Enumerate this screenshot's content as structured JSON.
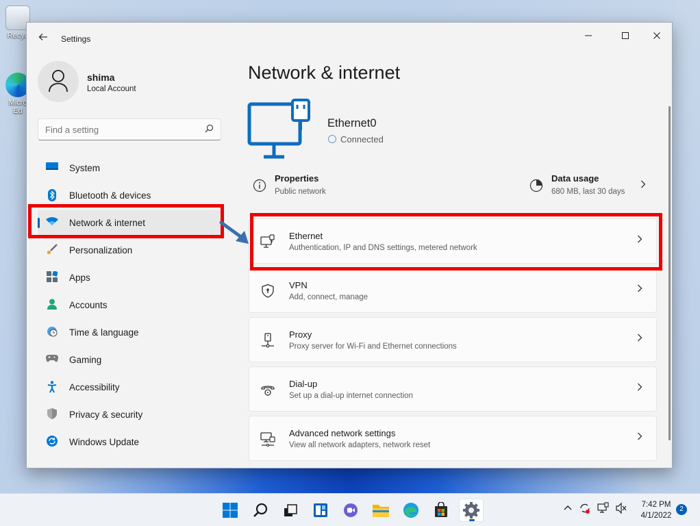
{
  "desktop": {
    "icons": [
      {
        "label": "Recycle Bin",
        "visible_label": "Recyc"
      },
      {
        "label": "Microsoft Edge",
        "visible_label": "Micro Ed"
      }
    ]
  },
  "window": {
    "app_title": "Settings",
    "controls": {
      "minimize": "—",
      "maximize": "☐",
      "close": "✕"
    }
  },
  "profile": {
    "name": "shima",
    "account_type": "Local Account"
  },
  "search": {
    "placeholder": "Find a setting"
  },
  "sidebar": {
    "items": [
      {
        "label": "System",
        "icon": "system-icon",
        "selected": false
      },
      {
        "label": "Bluetooth & devices",
        "icon": "bluetooth-icon",
        "selected": false
      },
      {
        "label": "Network & internet",
        "icon": "wifi-icon",
        "selected": true
      },
      {
        "label": "Personalization",
        "icon": "brush-icon",
        "selected": false
      },
      {
        "label": "Apps",
        "icon": "apps-icon",
        "selected": false
      },
      {
        "label": "Accounts",
        "icon": "person-icon",
        "selected": false
      },
      {
        "label": "Time & language",
        "icon": "clock-globe-icon",
        "selected": false
      },
      {
        "label": "Gaming",
        "icon": "gamepad-icon",
        "selected": false
      },
      {
        "label": "Accessibility",
        "icon": "accessibility-icon",
        "selected": false
      },
      {
        "label": "Privacy & security",
        "icon": "shield-icon",
        "selected": false
      },
      {
        "label": "Windows Update",
        "icon": "update-icon",
        "selected": false
      }
    ]
  },
  "main": {
    "title": "Network & internet",
    "connection": {
      "name": "Ethernet0",
      "status": "Connected"
    },
    "properties": {
      "title": "Properties",
      "subtitle": "Public network"
    },
    "data_usage": {
      "title": "Data usage",
      "subtitle": "680 MB, last 30 days"
    },
    "cards": [
      {
        "title": "Ethernet",
        "subtitle": "Authentication, IP and DNS settings, metered network",
        "icon": "ethernet-icon"
      },
      {
        "title": "VPN",
        "subtitle": "Add, connect, manage",
        "icon": "vpn-shield-icon"
      },
      {
        "title": "Proxy",
        "subtitle": "Proxy server for Wi-Fi and Ethernet connections",
        "icon": "proxy-icon"
      },
      {
        "title": "Dial-up",
        "subtitle": "Set up a dial-up internet connection",
        "icon": "dialup-icon"
      },
      {
        "title": "Advanced network settings",
        "subtitle": "View all network adapters, network reset",
        "icon": "advanced-network-icon"
      }
    ]
  },
  "taskbar": {
    "apps": [
      "start",
      "search",
      "task-view",
      "widgets",
      "chat",
      "file-explorer",
      "edge",
      "store",
      "settings"
    ],
    "time": "7:42 PM",
    "date": "4/1/2022",
    "notification_count": "2"
  },
  "colors": {
    "accent": "#005fb8",
    "highlight": "#ee0000",
    "window_bg": "#f3f3f3"
  }
}
